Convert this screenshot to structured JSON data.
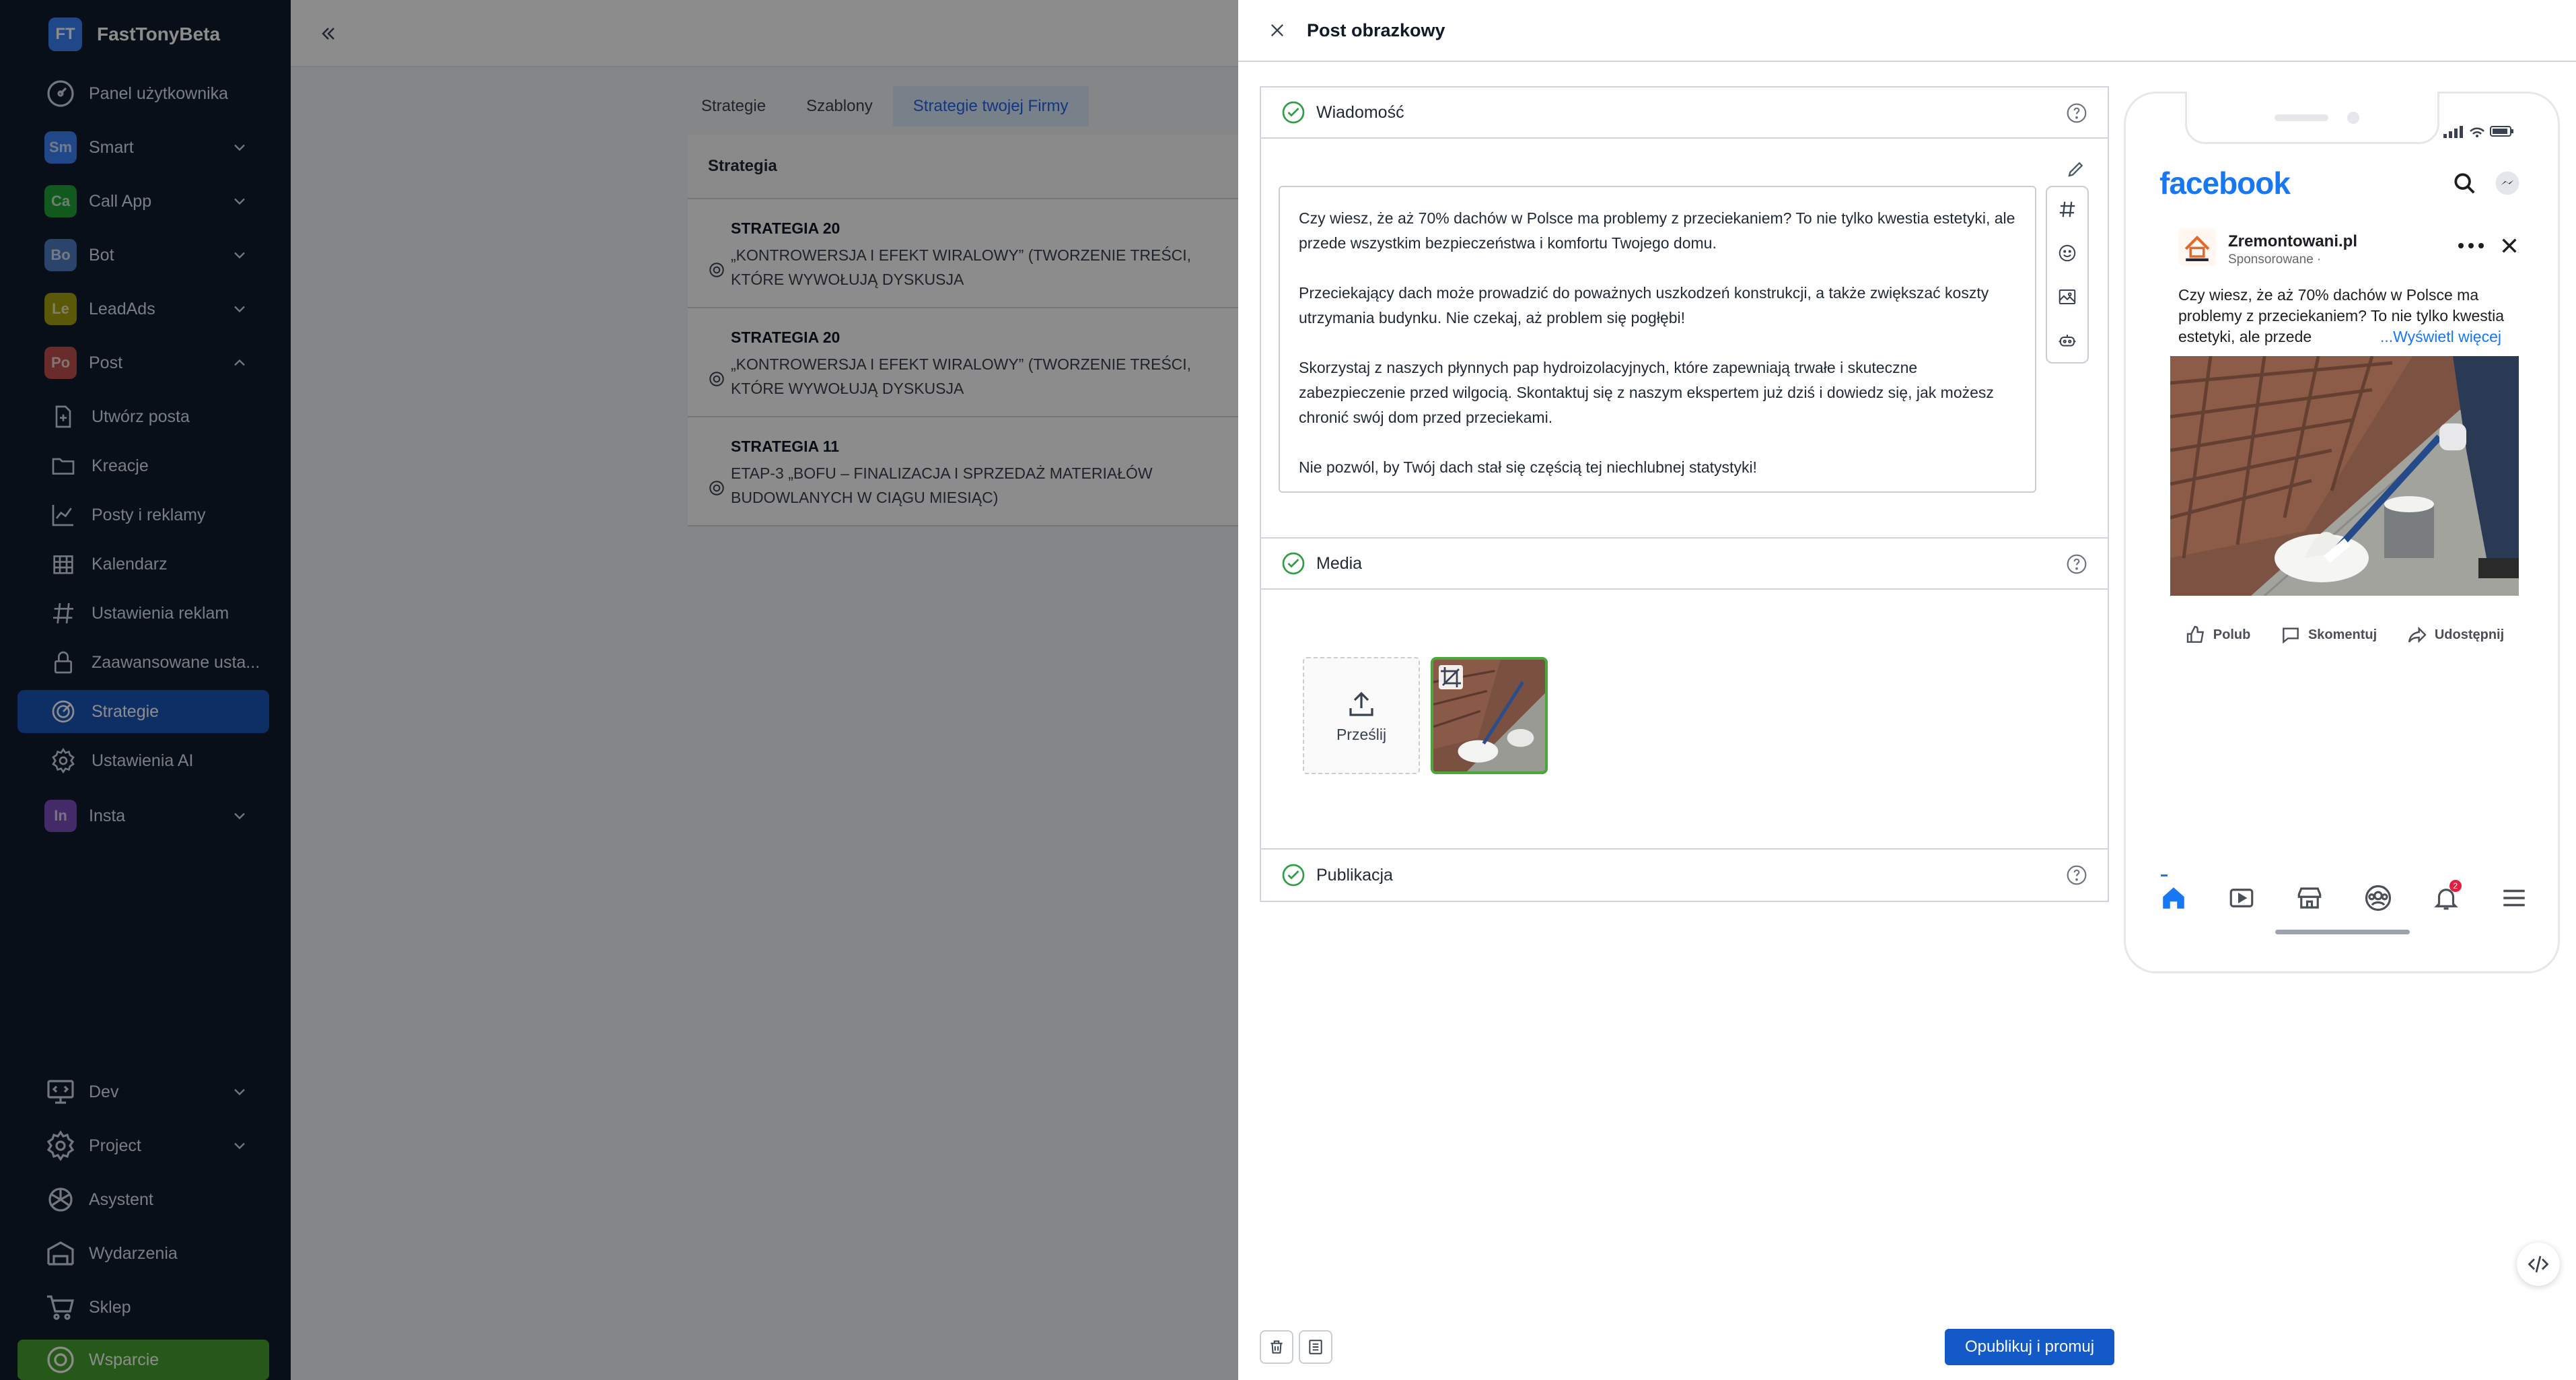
{
  "brand": {
    "initials": "FT",
    "name": "FastTonyBeta",
    "color": "#3b82f6"
  },
  "sidebar": {
    "items": [
      {
        "label": "Panel użytkownika",
        "icon": "dashboard-icon"
      },
      {
        "label": "Smart",
        "badge": "Sm",
        "badge_color": "#3b82f6"
      },
      {
        "label": "Call App",
        "badge": "Ca",
        "badge_color": "#22a33a"
      },
      {
        "label": "Bot",
        "badge": "Bo",
        "badge_color": "#4f7cc4"
      },
      {
        "label": "LeadAds",
        "badge": "Le",
        "badge_color": "#a6a30f"
      },
      {
        "label": "Post",
        "badge": "Po",
        "badge_color": "#c0504d"
      },
      {
        "label": "Utwórz posta",
        "icon": "file-plus-icon"
      },
      {
        "label": "Kreacje",
        "icon": "folder-icon"
      },
      {
        "label": "Posty i reklamy",
        "icon": "chart-line-icon"
      },
      {
        "label": "Kalendarz",
        "icon": "calendar-icon"
      },
      {
        "label": "Ustawienia reklam",
        "icon": "hash-icon"
      },
      {
        "label": "Zaawansowane usta...",
        "icon": "lock-icon"
      },
      {
        "label": "Strategie",
        "icon": "strategy-icon"
      },
      {
        "label": "Ustawienia AI",
        "icon": "gear-icon"
      },
      {
        "label": "Insta",
        "badge": "In",
        "badge_color": "#7c4dbe"
      },
      {
        "label": "Dev",
        "icon": "monitor-icon"
      },
      {
        "label": "Project",
        "icon": "gear-icon"
      },
      {
        "label": "Asystent",
        "icon": "openai-icon"
      },
      {
        "label": "Wydarzenia",
        "icon": "events-icon"
      },
      {
        "label": "Sklep",
        "icon": "cart-icon"
      },
      {
        "label": "Wsparcie",
        "icon": "support-icon"
      }
    ]
  },
  "main": {
    "tabs": [
      "Strategie",
      "Szablony",
      "Strategie twojej Firmy"
    ],
    "table": {
      "header": "Strategia",
      "rows": [
        {
          "name": "STRATEGIA 20",
          "desc": "„KONTROWERSJA I EFEKT WIRALOWY” (TWORZENIE TREŚCI, KTÓRE WYWOŁUJĄ DYSKUSJA"
        },
        {
          "name": "STRATEGIA 20",
          "desc": "„KONTROWERSJA I EFEKT WIRALOWY” (TWORZENIE TREŚCI, KTÓRE WYWOŁUJĄ DYSKUSJA"
        },
        {
          "name": "STRATEGIA 11",
          "desc": "ETAP-3 „BOFU – FINALIZACJA I SPRZEDAŻ MATERIAŁÓW BUDOWLANYCH W CIĄGU MIESIĄC)"
        }
      ]
    }
  },
  "drawer": {
    "title": "Post obrazkowy",
    "sections": {
      "message": "Wiadomość",
      "media": "Media",
      "publication": "Publikacja"
    },
    "message_paragraphs": [
      "Czy wiesz, że aż 70% dachów w Polsce ma problemy z przeciekaniem? To nie tylko kwestia estetyki, ale przede wszystkim bezpieczeństwa i komfortu Twojego domu.",
      "Przeciekający dach może prowadzić do poważnych uszkodzeń konstrukcji, a także zwiększać koszty utrzymania budynku. Nie czekaj, aż problem się pogłębi!",
      "Skorzystaj z naszych płynnych pap hydroizolacyjnych, które zapewniają trwałe i skuteczne zabezpieczenie przed wilgocią. Skontaktuj się z naszym ekspertem już dziś i dowiedz się, jak możesz chronić swój dom przed przeciekami.",
      "Nie pozwól, by Twój dach stał się częścią tej niechlubnej statystyki!"
    ],
    "upload_label": "Prześlij",
    "publish_label": "Opublikuj i promuj"
  },
  "preview": {
    "fb_logo": "facebook",
    "page_name": "Zremontowani.pl",
    "sponsored": "Sponsorowane ·",
    "text": "Czy wiesz, że aż 70% dachów w Polsce ma problemy z przeciekaniem? To nie tylko kwestia estetyki, ale przede",
    "see_more": "...Wyświetl więcej",
    "actions": [
      "Polub",
      "Skomentuj",
      "Udostępnij"
    ],
    "notification_count": "2"
  },
  "colors": {
    "sidebar_bg": "#111c2d",
    "active_item": "#1a56b8",
    "support_item": "#46a22e",
    "publish_button": "#1359c8",
    "success_check": "#4aa83a",
    "facebook_blue": "#1877f2"
  }
}
